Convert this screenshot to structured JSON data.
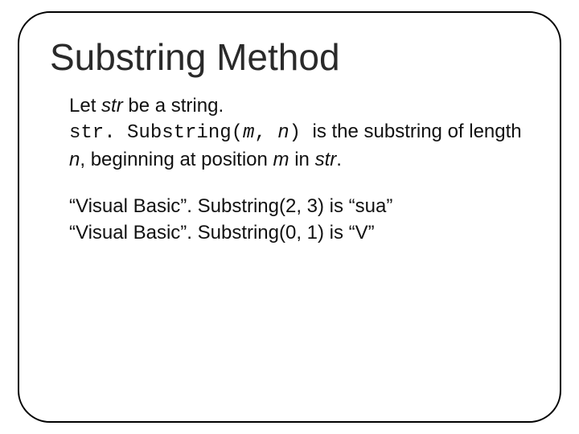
{
  "title": "Substring Method",
  "para1": {
    "pre": "Let ",
    "var1": "str",
    "post": " be a string."
  },
  "para2": {
    "code_pre": "str. Substring(",
    "code_arg1": "m",
    "code_mid": ", ",
    "code_arg2": "n",
    "code_post": ") ",
    "trail": "  is the substring of length",
    "line2_pre": "",
    "var_n": "n",
    "mid1": ", beginning at position ",
    "var_m": "m",
    "mid2": " in ",
    "var_str": "str",
    "end": "."
  },
  "ex1": "“Visual Basic”. Substring(2, 3) is “sua”",
  "ex2": "“Visual Basic”. Substring(0, 1) is “V”"
}
